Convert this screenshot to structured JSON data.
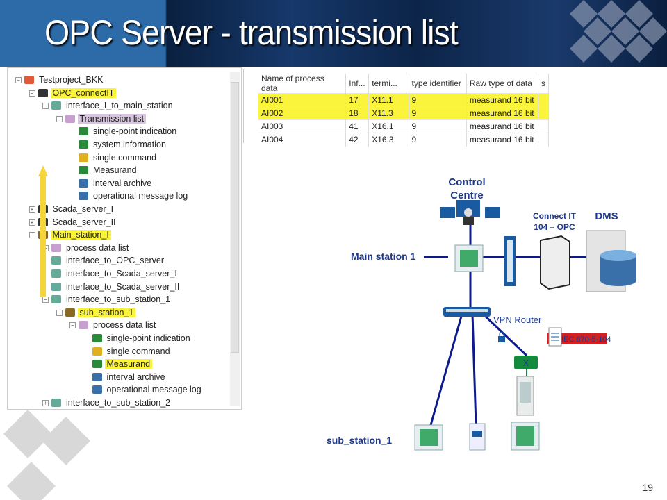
{
  "slide": {
    "title": "OPC Server - transmission list",
    "page_number": "19"
  },
  "tree": {
    "items": [
      {
        "label": "Testproject_BKK",
        "level": 0,
        "icon": "project-icon",
        "expander": "minus"
      },
      {
        "label": "OPC_connectIT",
        "level": 1,
        "icon": "computer-icon",
        "expander": "minus",
        "highlight": "yellow"
      },
      {
        "label": "interface_I_to_main_station",
        "level": 2,
        "icon": "interface-icon",
        "expander": "minus"
      },
      {
        "label": "Transmission list",
        "level": 3,
        "icon": "folder-list-icon",
        "expander": "minus",
        "highlight": "purple"
      },
      {
        "label": "single-point indication",
        "level": 4,
        "icon": "single-point-icon"
      },
      {
        "label": "system information",
        "level": 4,
        "icon": "system-info-icon"
      },
      {
        "label": "single command",
        "level": 4,
        "icon": "command-icon"
      },
      {
        "label": "Measurand",
        "level": 4,
        "icon": "measurand-icon"
      },
      {
        "label": "interval archive",
        "level": 4,
        "icon": "archive-icon"
      },
      {
        "label": "operational message log",
        "level": 4,
        "icon": "message-log-icon"
      },
      {
        "label": "Scada_server_I",
        "level": 1,
        "icon": "computer-icon",
        "expander": "plus"
      },
      {
        "label": "Scada_server_II",
        "level": 1,
        "icon": "computer-icon",
        "expander": "plus"
      },
      {
        "label": "Main_station_I",
        "level": 1,
        "icon": "station-icon",
        "expander": "minus",
        "highlight": "yellow"
      },
      {
        "label": "process data list",
        "level": 2,
        "icon": "folder-list-icon",
        "expander": "plus"
      },
      {
        "label": "interface_to_OPC_server",
        "level": 2,
        "icon": "interface-icon"
      },
      {
        "label": "interface_to_Scada_server_I",
        "level": 2,
        "icon": "interface-icon"
      },
      {
        "label": "interface_to_Scada_server_II",
        "level": 2,
        "icon": "interface-icon"
      },
      {
        "label": "interface_to_sub_station_1",
        "level": 2,
        "icon": "interface-icon",
        "expander": "minus"
      },
      {
        "label": "sub_station_1",
        "level": 3,
        "icon": "station-icon",
        "expander": "minus",
        "highlight": "yellow"
      },
      {
        "label": "process data list",
        "level": 4,
        "icon": "folder-list-icon",
        "expander": "minus"
      },
      {
        "label": "single-point indication",
        "level": 5,
        "icon": "single-point-icon"
      },
      {
        "label": "single command",
        "level": 5,
        "icon": "command-icon"
      },
      {
        "label": "Measurand",
        "level": 5,
        "icon": "measurand-icon",
        "highlight": "yellow"
      },
      {
        "label": "interval archive",
        "level": 5,
        "icon": "archive-icon"
      },
      {
        "label": "operational message log",
        "level": 5,
        "icon": "message-log-icon"
      },
      {
        "label": "interface_to_sub_station_2",
        "level": 2,
        "icon": "interface-icon",
        "expander": "plus"
      }
    ]
  },
  "table": {
    "columns": [
      "Name of process data",
      "Inf...",
      "termi...",
      "type identifier",
      "Raw type of data",
      "s"
    ],
    "rows": [
      {
        "cells": [
          "AI001",
          "17",
          "X11.1",
          "9",
          "measurand 16 bit"
        ],
        "highlight": true
      },
      {
        "cells": [
          "AI002",
          "18",
          "X11.3",
          "9",
          "measurand 16 bit"
        ],
        "highlight": true
      },
      {
        "cells": [
          "AI003",
          "41",
          "X16.1",
          "9",
          "measurand 16 bit"
        ],
        "highlight": false
      },
      {
        "cells": [
          "AI004",
          "42",
          "X16.3",
          "9",
          "measurand 16 bit"
        ],
        "highlight": false
      }
    ]
  },
  "diagram": {
    "control_centre_line1": "Control",
    "control_centre_line2": "Centre",
    "connect_it_line1": "Connect IT",
    "connect_it_line2": "104 – OPC",
    "dms": "DMS",
    "main_station": "Main station 1",
    "vpn_router": "VPN Router",
    "protocol": "IEC 870-5-104",
    "switch_label": "X",
    "sub_station": "sub_station_1"
  },
  "colors": {
    "highlight_yellow": "#fbf43c",
    "highlight_purple": "#d9c5df",
    "diagram_text": "#1f3a8a",
    "link_line": "#0d1a8c",
    "protocol_badge": "#d42020",
    "switch_green": "#138a3c"
  }
}
